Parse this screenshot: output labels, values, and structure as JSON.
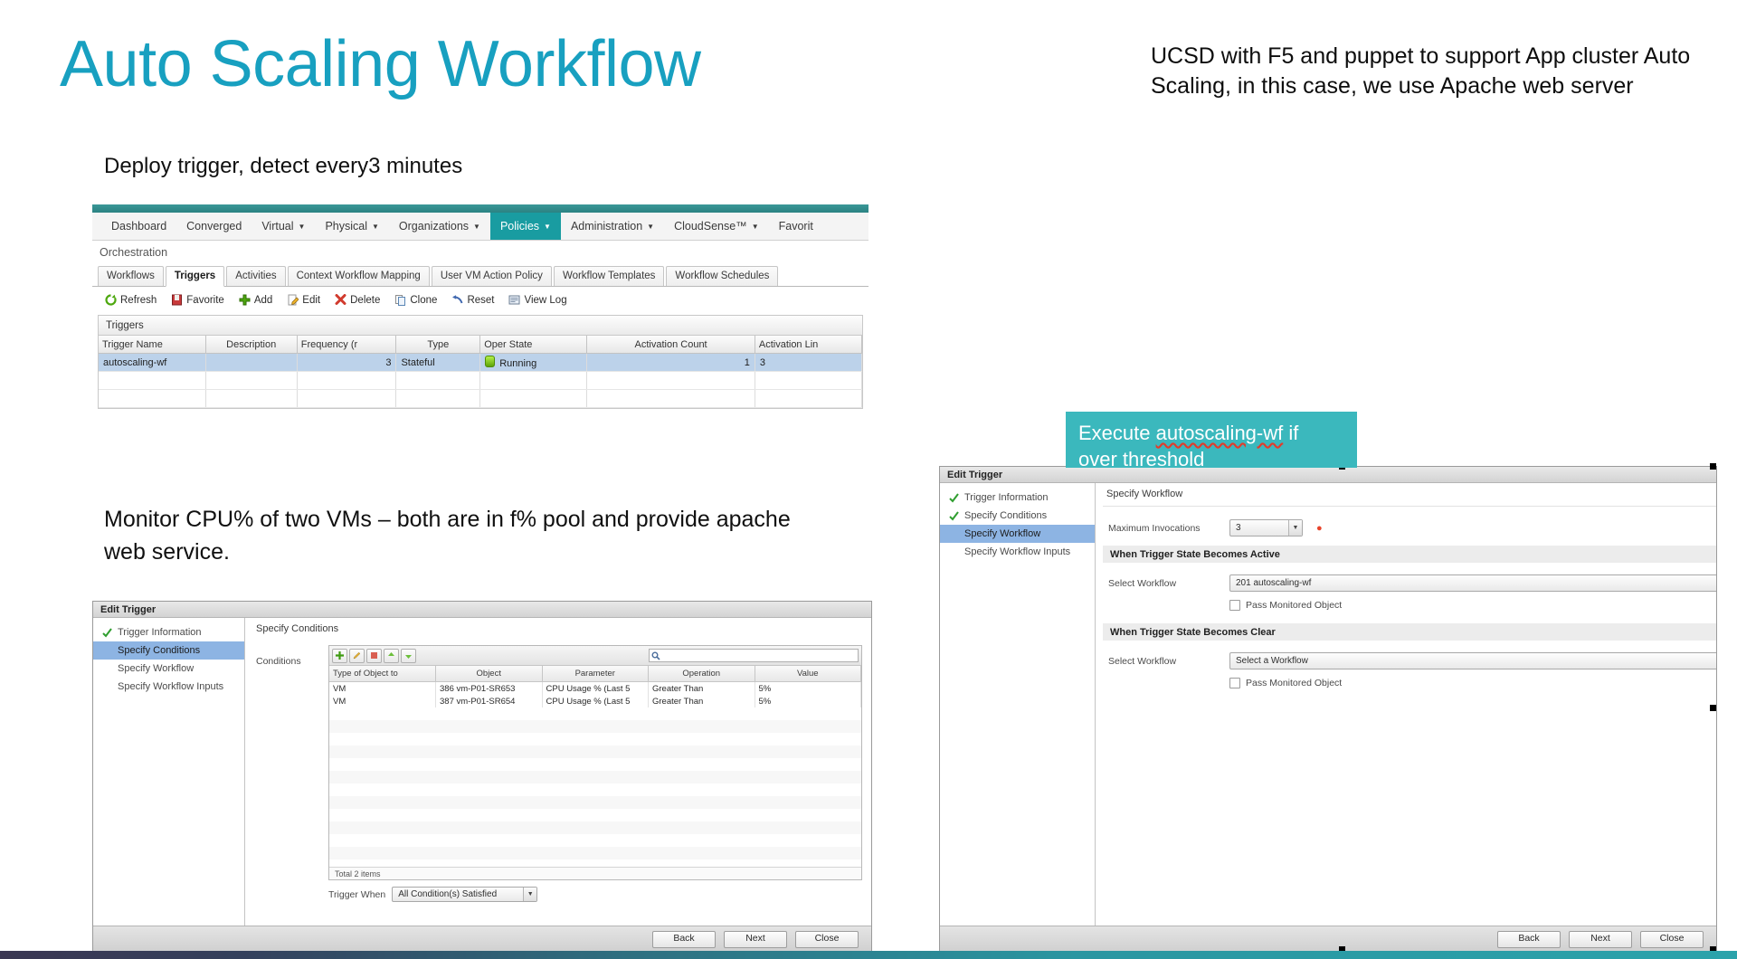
{
  "slide": {
    "title": "Auto Scaling Workflow",
    "note_top_right": "UCSD with F5 and puppet to support App cluster Auto Scaling, in this case, we use Apache web server",
    "caption_1": "Deploy trigger, detect every3 minutes",
    "caption_2": "Monitor CPU% of two VMs – both are in f% pool  and provide apache web service.",
    "accent_color": "#18a0c0",
    "callout_color": "#3bb8bd"
  },
  "callout": {
    "line1_prefix": "Execute ",
    "line1_emphasis": "autoscaling-wf",
    "line1_suffix": " if",
    "line2": "over threshold"
  },
  "triggers_screenshot": {
    "menu": [
      {
        "label": "Dashboard",
        "caret": false,
        "active": false
      },
      {
        "label": "Converged",
        "caret": false,
        "active": false
      },
      {
        "label": "Virtual",
        "caret": true,
        "active": false
      },
      {
        "label": "Physical",
        "caret": true,
        "active": false
      },
      {
        "label": "Organizations",
        "caret": true,
        "active": false
      },
      {
        "label": "Policies",
        "caret": true,
        "active": true
      },
      {
        "label": "Administration",
        "caret": true,
        "active": false
      },
      {
        "label": "CloudSense™",
        "caret": true,
        "active": false
      },
      {
        "label": "Favorit",
        "caret": false,
        "active": false
      }
    ],
    "breadcrumb": "Orchestration",
    "tabs": [
      {
        "label": "Workflows",
        "selected": false
      },
      {
        "label": "Triggers",
        "selected": true
      },
      {
        "label": "Activities",
        "selected": false
      },
      {
        "label": "Context Workflow Mapping",
        "selected": false
      },
      {
        "label": "User VM Action Policy",
        "selected": false
      },
      {
        "label": "Workflow Templates",
        "selected": false
      },
      {
        "label": "Workflow Schedules",
        "selected": false
      }
    ],
    "toolbar": [
      {
        "label": "Refresh",
        "icon": "refresh-icon"
      },
      {
        "label": "Favorite",
        "icon": "favorite-icon"
      },
      {
        "label": "Add",
        "icon": "add-icon"
      },
      {
        "label": "Edit",
        "icon": "edit-icon"
      },
      {
        "label": "Delete",
        "icon": "delete-icon"
      },
      {
        "label": "Clone",
        "icon": "clone-icon"
      },
      {
        "label": "Reset",
        "icon": "reset-icon"
      },
      {
        "label": "View Log",
        "icon": "view-log-icon"
      }
    ],
    "panel_header": "Triggers",
    "table": {
      "columns": [
        "Trigger Name",
        "Description",
        "Frequency (r",
        "Type",
        "Oper State",
        "Activation Count",
        "Activation Lin"
      ],
      "rows": [
        {
          "trigger_name": "autoscaling-wf",
          "description": "",
          "frequency": "3",
          "type": "Stateful",
          "oper_state": "Running",
          "activation_count": "1",
          "activation_limit": "3"
        }
      ]
    }
  },
  "edit_trigger_conditions": {
    "window_title": "Edit Trigger",
    "steps": [
      {
        "label": "Trigger Information",
        "done": true,
        "current": false
      },
      {
        "label": "Specify Conditions",
        "done": false,
        "current": true
      },
      {
        "label": "Specify Workflow",
        "done": false,
        "current": false
      },
      {
        "label": "Specify Workflow Inputs",
        "done": false,
        "current": false
      }
    ],
    "pane_title": "Specify Conditions",
    "conditions_label": "Conditions",
    "grid": {
      "columns": [
        "Type of Object to ",
        "Object",
        "Parameter",
        "Operation",
        "Value"
      ],
      "rows": [
        {
          "type": "VM",
          "object": "386 vm-P01-SR653",
          "parameter": "CPU Usage % (Last 5",
          "operation": "Greater Than",
          "value": "5%"
        },
        {
          "type": "VM",
          "object": "387 vm-P01-SR654",
          "parameter": "CPU Usage % (Last 5",
          "operation": "Greater Than",
          "value": "5%"
        }
      ],
      "footer": "Total 2 items"
    },
    "trigger_when_label": "Trigger When",
    "trigger_when_value": "All Condition(s) Satisfied",
    "buttons": [
      "Back",
      "Next",
      "Close"
    ]
  },
  "edit_trigger_workflow": {
    "window_title": "Edit Trigger",
    "steps": [
      {
        "label": "Trigger Information",
        "done": true,
        "current": false
      },
      {
        "label": "Specify Conditions",
        "done": true,
        "current": false
      },
      {
        "label": "Specify Workflow",
        "done": false,
        "current": true
      },
      {
        "label": "Specify Workflow Inputs",
        "done": false,
        "current": false
      }
    ],
    "pane_title": "Specify Workflow",
    "max_invocations_label": "Maximum Invocations",
    "max_invocations_value": "3",
    "section_active": "When Trigger State Becomes Active",
    "section_clear": "When Trigger State Becomes Clear",
    "select_workflow_label": "Select Workflow",
    "active_workflow_value": "201 autoscaling-wf",
    "clear_workflow_value": "Select a Workflow",
    "pass_monitored_object_label": "Pass Monitored Object",
    "buttons": [
      "Back",
      "Next",
      "Close"
    ]
  }
}
